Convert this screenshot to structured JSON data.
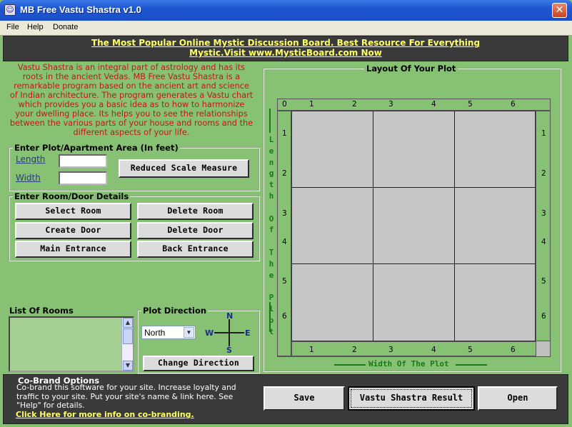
{
  "window": {
    "title": "MB Free Vastu Shastra v1.0",
    "close_glyph": "✕"
  },
  "menu": {
    "file": "File",
    "help": "Help",
    "donate": "Donate"
  },
  "banner": {
    "text": "The Most Popular Online Mystic Discussion Board. Best Resource For Everything Mystic.Visit www.MysticBoard.com Now"
  },
  "intro": "Vastu Shastra is an integral part of astrology and has its roots in the ancient Vedas. MB Free Vastu Shastra is a remarkable program based on the ancient art and science of Indian architecture. The program generates a Vastu chart which provides you a basic idea as to how to harmonize your dwelling place. Its helps you to see the  relationships between the various parts of your house and rooms and the different aspects of your life.",
  "plot_area": {
    "legend": "Enter Plot/Apartment Area (In feet)",
    "length_label": "Length",
    "width_label": "Width",
    "length_value": "",
    "width_value": "",
    "reduced_scale_button": "Reduced Scale Measure"
  },
  "room_door": {
    "legend": "Enter Room/Door Details",
    "select_room": "Select Room",
    "delete_room": "Delete Room",
    "create_door": "Create Door",
    "delete_door": "Delete Door",
    "main_entrance": "Main Entrance",
    "back_entrance": "Back Entrance"
  },
  "rooms_list": {
    "label": "List Of Rooms"
  },
  "plot_direction": {
    "legend": "Plot Direction",
    "selected": "North",
    "n": "N",
    "s": "S",
    "e": "E",
    "w": "W",
    "change_button": "Change Direction"
  },
  "plot": {
    "title": "Layout Of Your Plot",
    "corner": "0",
    "cols": [
      "1",
      "2",
      "3",
      "4",
      "5",
      "6"
    ],
    "rows": [
      "1",
      "2",
      "3",
      "4",
      "5",
      "6"
    ],
    "length_label": "Length Of The Plot",
    "width_label": "Width Of The Plot"
  },
  "cobrand": {
    "title": "Co-Brand Options",
    "text": "Co-brand this software for your site.  Increase loyalty and traffic to your site. Put your site's name & link here. See \"Help\" for details.",
    "link": "Click Here for more info on co-branding."
  },
  "actions": {
    "save": "Save",
    "result": "Vastu Shastra Result",
    "open": "Open"
  },
  "colors": {
    "window_bg": "#86c174",
    "banner_bg": "#3a3a3a",
    "banner_text": "#ffff66",
    "intro_text": "#c0181a",
    "axis_label": "#1a7a1a",
    "compass": "#1b2b8a"
  }
}
